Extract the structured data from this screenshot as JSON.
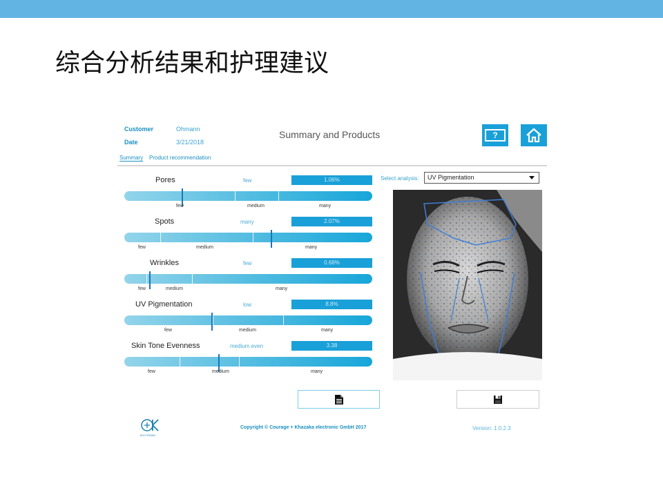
{
  "slide": {
    "title": "综合分析结果和护理建议",
    "topbar_color": "#62b4e2"
  },
  "app": {
    "customer_label": "Customer",
    "customer_value": "Ohmann",
    "date_label": "Date",
    "date_value": "3/21/2018",
    "title": "Summary and Products",
    "help_icon_text": "?",
    "tabs": [
      "Summary",
      "Product recommendation"
    ],
    "accent_color": "#1aa0d8",
    "metrics": [
      {
        "name": "Pores",
        "level": "few",
        "value": "1.06%",
        "scale": [
          "few",
          "medium",
          "many"
        ],
        "marker_fraction": 0.23
      },
      {
        "name": "Spots",
        "level": "many",
        "value": "2.07%",
        "scale": [
          "few",
          "medium",
          "many"
        ],
        "marker_fraction": 0.59
      },
      {
        "name": "Wrinkles",
        "level": "few",
        "value": "0.68%",
        "scale": [
          "few",
          "medium",
          "many"
        ],
        "marker_fraction": 0.1
      },
      {
        "name": "UV Pigmentation",
        "level": "low",
        "value": "8.8%",
        "scale": [
          "few",
          "medium",
          "many"
        ],
        "marker_fraction": 0.35
      },
      {
        "name": "Skin Tone Evenness",
        "level": "medium even",
        "value": "3.38",
        "scale": [
          "few",
          "medium",
          "many"
        ],
        "marker_fraction": 0.38
      }
    ],
    "select_label": "Select analysis:",
    "select_value": "UV Pigmentation",
    "buttons": {
      "document_icon": "document-icon",
      "save_icon": "save-icon"
    },
    "logo_text": "CK",
    "logo_subtext": "ELECTRONIC",
    "copyright": "Copyright © Courage + Khazaka electronic GmbH 2017",
    "version": "Version: 1.0.2.3"
  }
}
